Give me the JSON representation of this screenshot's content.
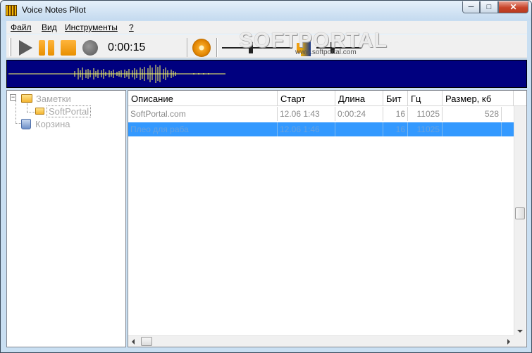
{
  "window": {
    "title": "Voice Notes Pilot"
  },
  "caption_buttons": {
    "minimize": "─",
    "maximize": "□",
    "close": "✕"
  },
  "menu": {
    "items": [
      {
        "label": "Файл"
      },
      {
        "label": "Вид"
      },
      {
        "label": "Инструменты"
      },
      {
        "label": "?"
      }
    ]
  },
  "toolbar": {
    "time": "0:00:15",
    "icons": [
      "play-icon",
      "pause-icon",
      "stop-icon",
      "record-icon",
      "settings-icon",
      "volume-icon"
    ],
    "playback_position_fraction": 0.4,
    "volume_level_fraction": 0.35
  },
  "watermark": {
    "text": "SOFTPORTAL",
    "url": "www.softportal.com"
  },
  "waveform": {
    "background": "#00007f",
    "wave_color": "#ffff66"
  },
  "tree": {
    "items": [
      {
        "label": "Заметки",
        "icon": "folder-open-icon"
      },
      {
        "label": "SoftPortal",
        "icon": "folder-icon"
      },
      {
        "label": "Корзина",
        "icon": "recycle-bin-icon"
      }
    ]
  },
  "list": {
    "columns": [
      {
        "label": "Описание"
      },
      {
        "label": "Старт"
      },
      {
        "label": "Длина"
      },
      {
        "label": "Бит"
      },
      {
        "label": "Гц"
      },
      {
        "label": "Размер, кб"
      }
    ],
    "rows": [
      {
        "description": "SoftPortal.com",
        "start": "12.06 1:43",
        "length": "0:00:24",
        "bits": "16",
        "hz": "11025",
        "size": "528"
      },
      {
        "description": "Плео для раба",
        "start": "12.06 1:46",
        "length": "",
        "bits": "16",
        "hz": "11025",
        "size": ""
      }
    ]
  },
  "colors": {
    "selection": "#3399ff",
    "title_gradient_top": "#e5f0fa",
    "accent_orange": "#e88f00"
  }
}
